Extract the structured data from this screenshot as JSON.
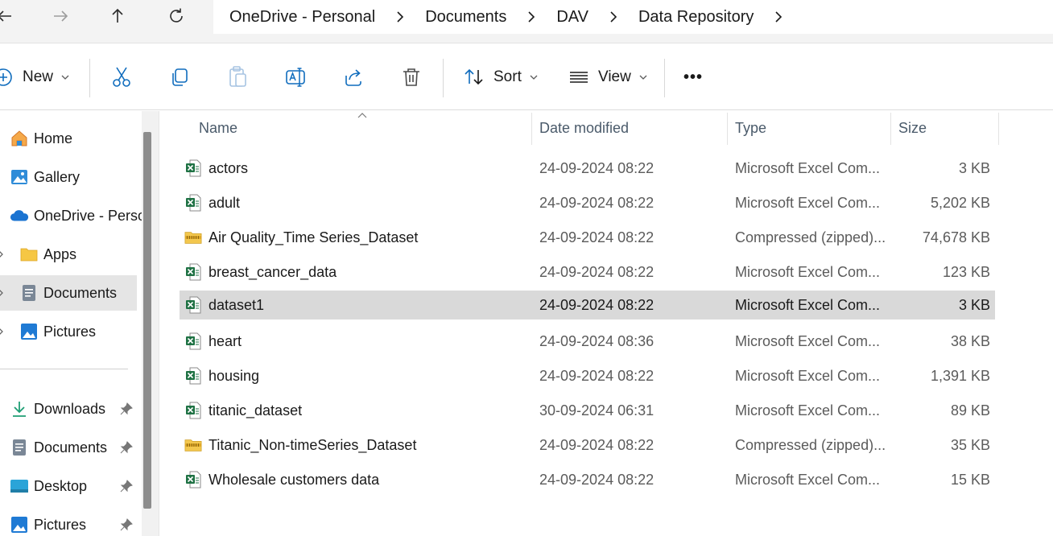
{
  "address_bar": {
    "breadcrumbs": [
      "OneDrive - Personal",
      "Documents",
      "DAV",
      "Data Repository"
    ]
  },
  "command_bar": {
    "new_label": "New",
    "sort_label": "Sort",
    "view_label": "View",
    "more_label": "•••"
  },
  "sidebar": {
    "home": "Home",
    "gallery": "Gallery",
    "onedrive": "OneDrive - Perso",
    "apps": "Apps",
    "documents": "Documents",
    "pictures": "Pictures",
    "quick_access": {
      "downloads": "Downloads",
      "documents": "Documents",
      "desktop": "Desktop",
      "pictures": "Pictures"
    }
  },
  "file_list": {
    "columns": {
      "name": "Name",
      "date": "Date modified",
      "type": "Type",
      "size": "Size"
    },
    "rows": [
      {
        "name": "actors",
        "date": "24-09-2024 08:22",
        "type": "Microsoft Excel Com...",
        "size": "3 KB",
        "icon": "excel-file-icon"
      },
      {
        "name": "adult",
        "date": "24-09-2024 08:22",
        "type": "Microsoft Excel Com...",
        "size": "5,202 KB",
        "icon": "excel-file-icon"
      },
      {
        "name": "Air Quality_Time Series_Dataset",
        "date": "24-09-2024 08:22",
        "type": "Compressed (zipped)...",
        "size": "74,678 KB",
        "icon": "zip-folder-icon"
      },
      {
        "name": "breast_cancer_data",
        "date": "24-09-2024 08:22",
        "type": "Microsoft Excel Com...",
        "size": "123 KB",
        "icon": "excel-file-icon"
      },
      {
        "name": "dataset1",
        "date": "24-09-2024 08:22",
        "type": "Microsoft Excel Com...",
        "size": "3 KB",
        "icon": "excel-file-icon"
      },
      {
        "name": "heart",
        "date": "24-09-2024 08:36",
        "type": "Microsoft Excel Com...",
        "size": "38 KB",
        "icon": "excel-file-icon"
      },
      {
        "name": "housing",
        "date": "24-09-2024 08:22",
        "type": "Microsoft Excel Com...",
        "size": "1,391 KB",
        "icon": "excel-file-icon"
      },
      {
        "name": "titanic_dataset",
        "date": "30-09-2024 06:31",
        "type": "Microsoft Excel Com...",
        "size": "89 KB",
        "icon": "excel-file-icon"
      },
      {
        "name": "Titanic_Non-timeSeries_Dataset",
        "date": "24-09-2024 08:22",
        "type": "Compressed (zipped)...",
        "size": "35 KB",
        "icon": "zip-folder-icon"
      },
      {
        "name": "Wholesale customers data",
        "date": "24-09-2024 08:22",
        "type": "Microsoft Excel Com...",
        "size": "15 KB",
        "icon": "excel-file-icon"
      }
    ],
    "selected_row": "dataset1"
  },
  "colors": {
    "selected_row_bg": "#d9d9d9",
    "sidebar_selected_bg": "#e5e5e5",
    "excel_green": "#1f7244",
    "zip_yellow": "#e8b93a",
    "accent_blue": "#0f6cbd"
  }
}
